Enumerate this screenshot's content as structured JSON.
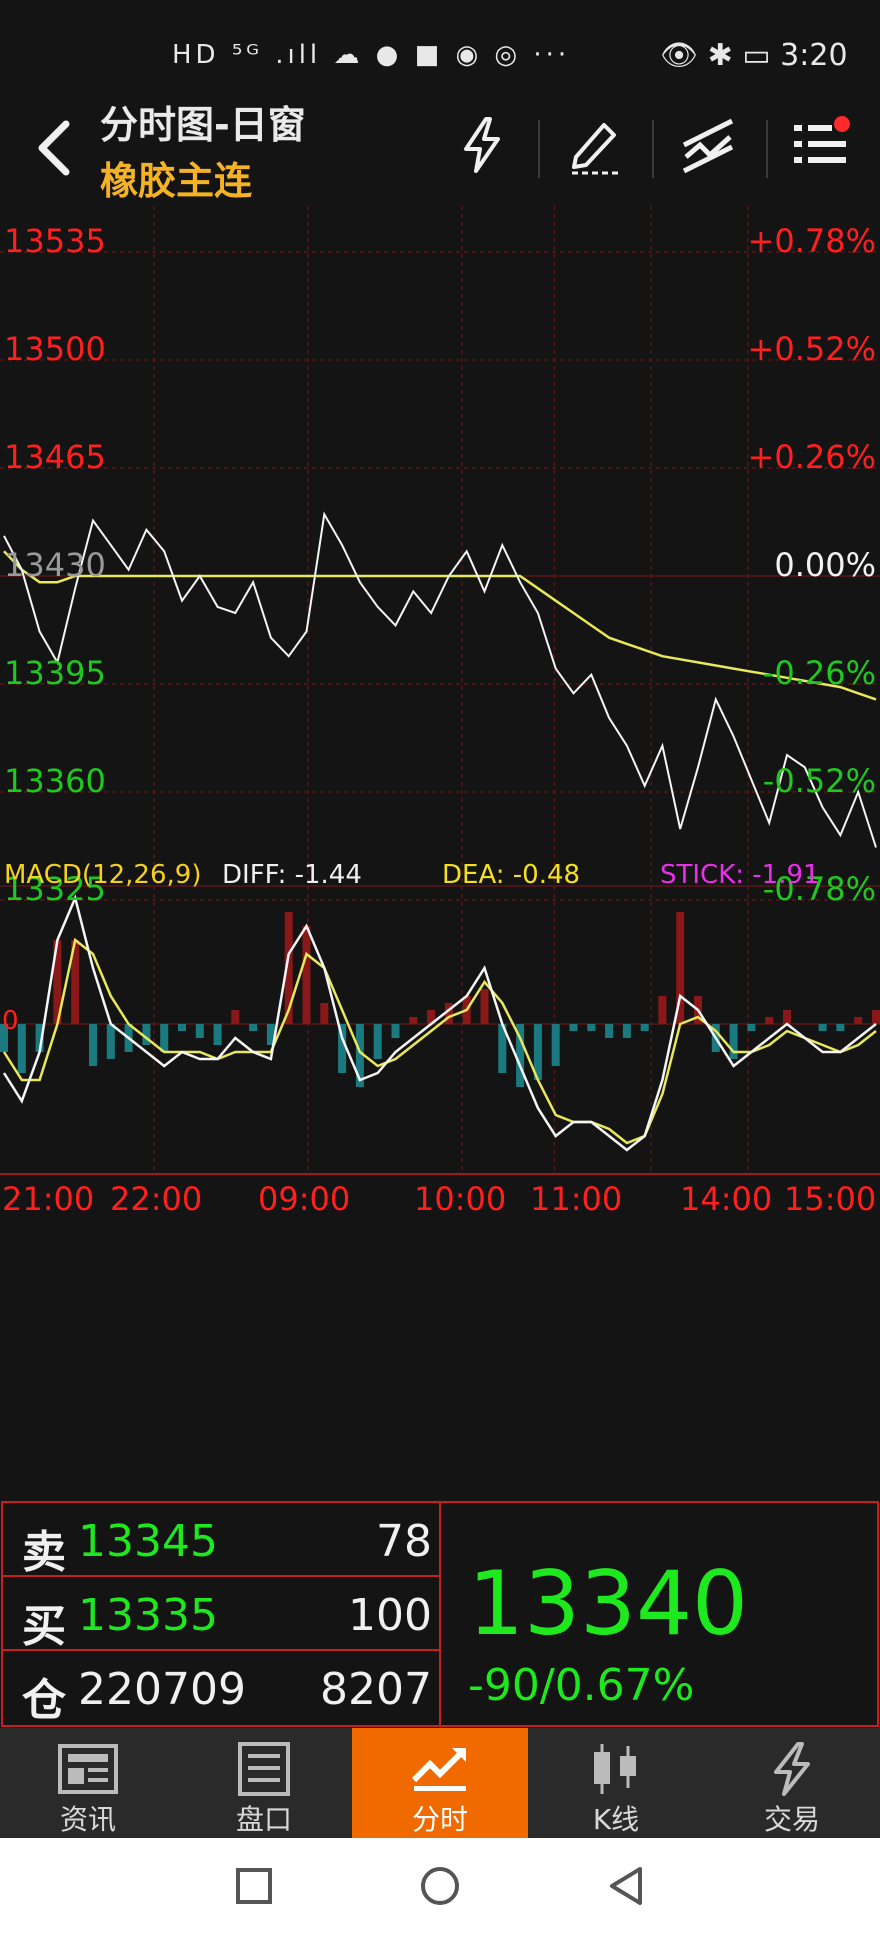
{
  "status_bar": {
    "left_icons": "HD ⁵ᴳ .ıll ☁ ● ■ ◉ ◎ ···",
    "right_text": "👁 ✱ ▭ 3:20"
  },
  "header": {
    "title": "分时图-日窗",
    "subtitle": "橡胶主连"
  },
  "price_axis": {
    "left": [
      "13535",
      "13500",
      "13465",
      "13430",
      "13395",
      "13360",
      "13325"
    ],
    "right": [
      "+0.78%",
      "+0.52%",
      "+0.26%",
      "0.00%",
      "-0.26%",
      "-0.52%",
      "-0.78%"
    ]
  },
  "macd": {
    "title": "MACD(12,26,9)",
    "diff": "DIFF: -1.44",
    "dea": "DEA: -0.48",
    "stick": "STICK: -1.91",
    "zero": "0"
  },
  "time_axis": [
    "21:00",
    "22:00",
    "09:00",
    "10:00",
    "11:00",
    "14:00",
    "15:00"
  ],
  "quote": {
    "sell_label": "卖",
    "sell_price": "13345",
    "sell_vol": "78",
    "buy_label": "买",
    "buy_price": "13335",
    "buy_vol": "100",
    "pos_label": "仓",
    "pos_value": "220709",
    "pos_change": "8207",
    "last_price": "13340",
    "change": "-90/0.67%"
  },
  "nav": [
    {
      "label": "资讯"
    },
    {
      "label": "盘口"
    },
    {
      "label": "分时"
    },
    {
      "label": "K线"
    },
    {
      "label": "交易"
    }
  ],
  "colors": {
    "up": "#ff1f1f",
    "down": "#1ec81e",
    "accent": "#f06a00",
    "avg_line": "#e8e85a"
  },
  "chart_data": {
    "type": "line",
    "title": "",
    "ylim": [
      13325,
      13535
    ],
    "x": [
      "21:00",
      "22:00",
      "09:00",
      "10:00",
      "11:00",
      "14:00",
      "15:00"
    ],
    "series": [
      {
        "values": [
          13443,
          13432,
          13412,
          13402,
          13426,
          13448,
          13440,
          13432,
          13445,
          13438,
          13422,
          13430,
          13420,
          13418,
          13428,
          13410,
          13404,
          13412,
          13450,
          13440,
          13428,
          13420,
          13414,
          13425,
          13418,
          13430,
          13438,
          13425,
          13440,
          13428,
          13418,
          13400,
          13392,
          13398,
          13384,
          13375,
          13362,
          13375,
          13348,
          13368,
          13390,
          13378,
          13364,
          13350,
          13372,
          13368,
          13355,
          13346,
          13360,
          13342
        ]
      },
      {
        "values": [
          13438,
          13432,
          13428,
          13428,
          13430,
          13430,
          13430,
          13430,
          13430,
          13430,
          13430,
          13430,
          13430,
          13430,
          13430,
          13430,
          13430,
          13430,
          13430,
          13430,
          13430,
          13430,
          13430,
          13430,
          13430,
          13430,
          13430,
          13430,
          13430,
          13430,
          13426,
          13422,
          13418,
          13414,
          13410,
          13408,
          13406,
          13404,
          13403,
          13402,
          13401,
          13400,
          13399,
          13398,
          13397,
          13396,
          13395,
          13394,
          13392,
          13390
        ]
      }
    ],
    "macd_diff": [
      -3.5,
      -5.5,
      -2,
      6,
      9,
      4,
      0,
      -1,
      -2,
      -3,
      -2,
      -2.5,
      -2.5,
      -1,
      -2,
      -2.5,
      5,
      7,
      4,
      -1,
      -4,
      -3.5,
      -2,
      -1,
      0,
      1,
      2,
      4,
      0,
      -3,
      -6,
      -8,
      -7,
      -7,
      -8,
      -9,
      -8,
      -4,
      2,
      1,
      -1,
      -3,
      -2,
      -1,
      0,
      -1,
      -2,
      -2,
      -1,
      0
    ],
    "macd_dea": [
      -2,
      -4,
      -4,
      0,
      6,
      5,
      2,
      0,
      -1,
      -2,
      -2,
      -2,
      -2.5,
      -2,
      -2,
      -2,
      1,
      5,
      4,
      1,
      -2,
      -3,
      -2.5,
      -1.5,
      -0.5,
      0.5,
      1,
      3,
      1.5,
      -1,
      -4,
      -6.5,
      -7,
      -7,
      -7.5,
      -8.5,
      -8,
      -5,
      0,
      0.5,
      -0.5,
      -2,
      -2,
      -1.5,
      -0.5,
      -1,
      -1.5,
      -2,
      -1.5,
      -0.5
    ],
    "macd_stick": [
      -4,
      -7,
      -4,
      12,
      12,
      -6,
      -5,
      -4,
      -3,
      -4,
      -1,
      -2,
      -3,
      2,
      -1,
      -3,
      16,
      14,
      3,
      -7,
      -9,
      -5,
      -2,
      1,
      2,
      3,
      4,
      5,
      -7,
      -9,
      -8,
      -6,
      -1,
      -1,
      -2,
      -2,
      -1,
      4,
      16,
      4,
      -4,
      -5,
      -1,
      1,
      2,
      0,
      -1,
      -1,
      1,
      2
    ]
  }
}
